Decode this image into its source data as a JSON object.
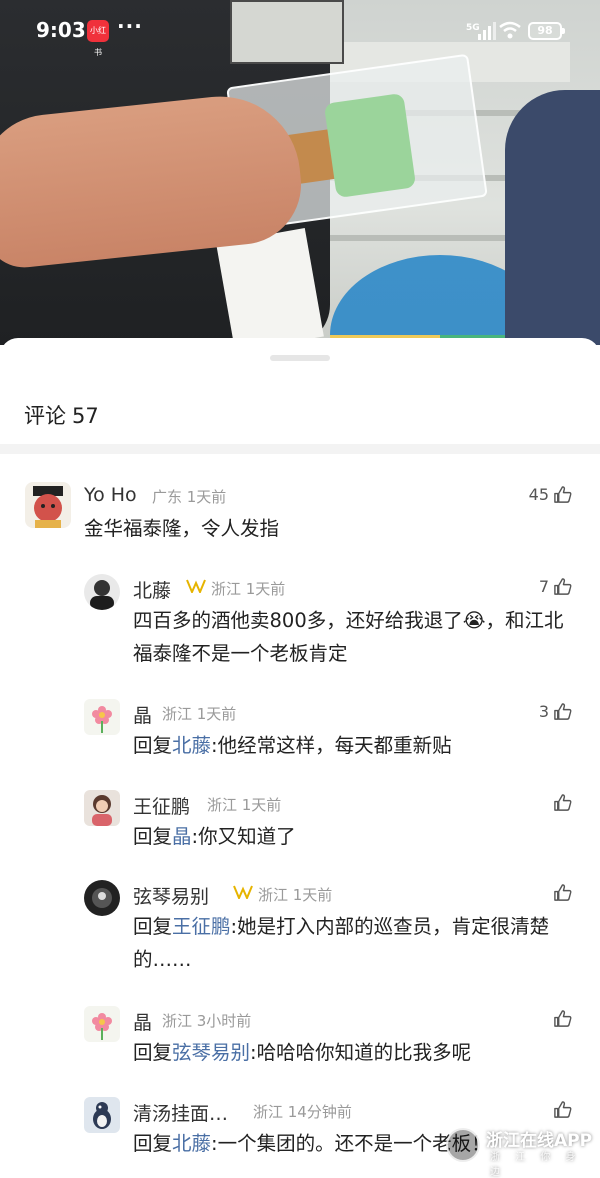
{
  "status_bar": {
    "time": "9:03",
    "app_badge": "小红书",
    "menu_dots": "···",
    "network": "5G",
    "battery": "98"
  },
  "sheet": {
    "title": "评论",
    "count": "57"
  },
  "comments": [
    {
      "name": "Yo Ho",
      "meta": "广东 1天前",
      "likes": "45",
      "text": "金华福泰隆，令人发指"
    },
    {
      "name": "北藤",
      "meta": "浙江 1天前",
      "likes": "7",
      "text": "四百多的酒他卖800多，还好给我退了😭，和江北福泰隆不是一个老板肯定"
    },
    {
      "name": "晶",
      "meta": "浙江 1天前",
      "likes": "3",
      "reply_prefix": "回复",
      "reply_to": "北藤",
      "text": ":他经常这样，每天都重新贴"
    },
    {
      "name": "王征鹏",
      "meta": "浙江 1天前",
      "likes": "",
      "reply_prefix": "回复",
      "reply_to": "晶",
      "text": ":你又知道了"
    },
    {
      "name": "弦琴易别",
      "meta": "浙江 1天前",
      "likes": "",
      "reply_prefix": "回复",
      "reply_to": "王征鹏",
      "text": ":她是打入内部的巡查员，肯定很清楚的……"
    },
    {
      "name": "晶",
      "meta": "浙江 3小时前",
      "likes": "",
      "reply_prefix": "回复",
      "reply_to": "弦琴易别",
      "text": ":哈哈哈你知道的比我多呢"
    },
    {
      "name": "清汤挂面…",
      "meta": "浙江 14分钟前",
      "likes": "",
      "reply_prefix": "回复",
      "reply_to": "北藤",
      "text": ":一个集团的。还不是一个老板！"
    }
  ],
  "watermark": {
    "text": "浙江在线APP",
    "sub": "浙 江 你 身 边"
  }
}
